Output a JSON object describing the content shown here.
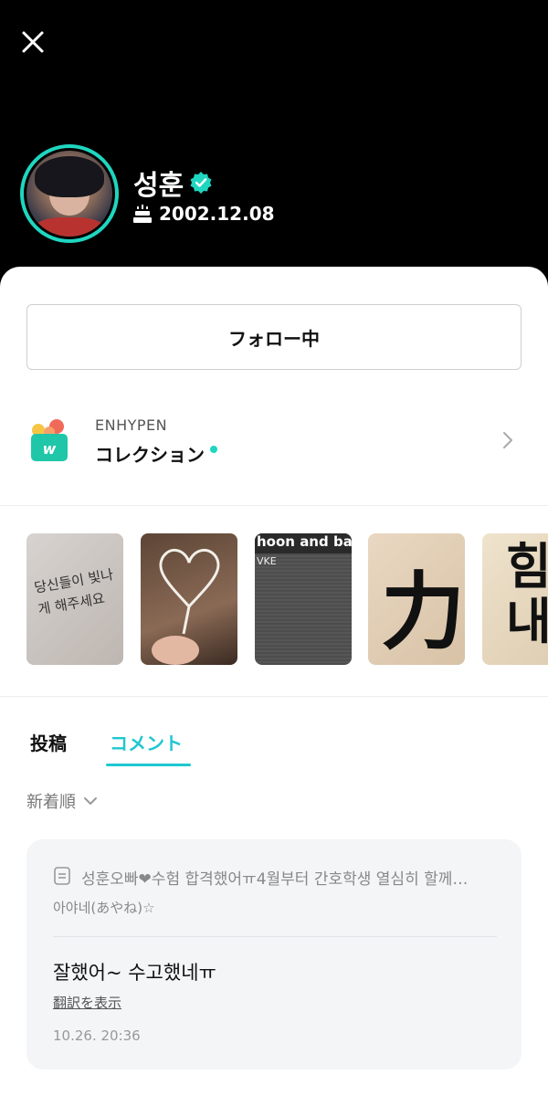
{
  "header": {
    "close_icon": "close-icon",
    "name": "성훈",
    "birthday": "2002.12.08",
    "accent_color": "#1fd6c0"
  },
  "follow": {
    "label": "フォロー中"
  },
  "collection": {
    "group": "ENHYPEN",
    "title": "コレクション"
  },
  "thumbnails": [
    {
      "text": "당신들이 빛나게 해주세요"
    },
    {
      "text": ""
    },
    {
      "text": "hoon and bac",
      "sub": "VKE"
    },
    {
      "text": "力"
    },
    {
      "text": "힘내"
    }
  ],
  "tabs": {
    "posts": "投稿",
    "comments": "コメント",
    "active": "comments"
  },
  "sort": {
    "label": "新着順"
  },
  "comment": {
    "ref_text": "성훈오빠❤수험 합격했어ㅠ4월부터 간호학생 열심히 할께…",
    "author": "아야네(あやね)☆",
    "body": "잘했어~ 수고했네ㅠ",
    "translate": "翻訳を表示",
    "time": "10.26. 20:36"
  }
}
